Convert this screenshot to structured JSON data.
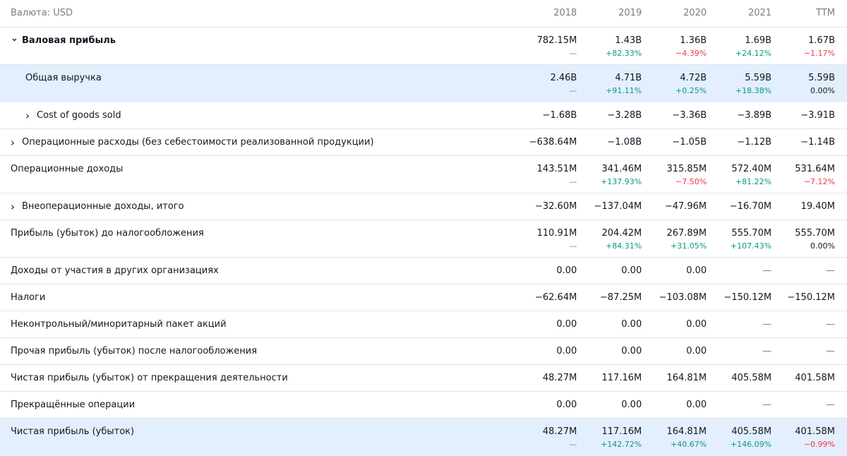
{
  "header": {
    "currency_label": "Валюта: USD",
    "years": [
      "2018",
      "2019",
      "2020",
      "2021",
      "TTM"
    ]
  },
  "rows": [
    {
      "label": "Валовая прибыль",
      "bold": true,
      "chevron": "chevron-down",
      "values": [
        "782.15M",
        "1.43B",
        "1.36B",
        "1.69B",
        "1.67B"
      ],
      "changes": [
        "—",
        "+82.33%",
        "−4.39%",
        "+24.12%",
        "−1.17%"
      ]
    },
    {
      "label": "Общая выручка",
      "highlight": true,
      "indent": true,
      "values": [
        "2.46B",
        "4.71B",
        "4.72B",
        "5.59B",
        "5.59B"
      ],
      "changes": [
        "—",
        "+91.11%",
        "+0.25%",
        "+18.38%",
        "0.00%"
      ]
    },
    {
      "label": "Cost of goods sold",
      "indent": true,
      "chevron": "chevron-right",
      "values": [
        "−1.68B",
        "−3.28B",
        "−3.36B",
        "−3.89B",
        "−3.91B"
      ]
    },
    {
      "label": "Операционные расходы (без себестоимости реализованной продукции)",
      "chevron": "chevron-right",
      "values": [
        "−638.64M",
        "−1.08B",
        "−1.05B",
        "−1.12B",
        "−1.14B"
      ]
    },
    {
      "label": "Операционные доходы",
      "values": [
        "143.51M",
        "341.46M",
        "315.85M",
        "572.40M",
        "531.64M"
      ],
      "changes": [
        "—",
        "+137.93%",
        "−7.50%",
        "+81.22%",
        "−7.12%"
      ]
    },
    {
      "label": "Внеоперационные доходы, итого",
      "chevron": "chevron-right",
      "values": [
        "−32.60M",
        "−137.04M",
        "−47.96M",
        "−16.70M",
        "19.40M"
      ]
    },
    {
      "label": "Прибыль (убыток) до налогообложения",
      "values": [
        "110.91M",
        "204.42M",
        "267.89M",
        "555.70M",
        "555.70M"
      ],
      "changes": [
        "—",
        "+84.31%",
        "+31.05%",
        "+107.43%",
        "0.00%"
      ]
    },
    {
      "label": "Доходы от участия в других организациях",
      "values": [
        "0.00",
        "0.00",
        "0.00",
        "—",
        "—"
      ]
    },
    {
      "label": "Налоги",
      "values": [
        "−62.64M",
        "−87.25M",
        "−103.08M",
        "−150.12M",
        "−150.12M"
      ]
    },
    {
      "label": "Неконтрольный/миноритарный пакет акций",
      "values": [
        "0.00",
        "0.00",
        "0.00",
        "—",
        "—"
      ]
    },
    {
      "label": "Прочая прибыль (убыток) после налогообложения",
      "values": [
        "0.00",
        "0.00",
        "0.00",
        "—",
        "—"
      ]
    },
    {
      "label": "Чистая прибыль (убыток) от прекращения деятельности",
      "values": [
        "48.27M",
        "117.16M",
        "164.81M",
        "405.58M",
        "401.58M"
      ]
    },
    {
      "label": "Прекращённые операции",
      "values": [
        "0.00",
        "0.00",
        "0.00",
        "—",
        "—"
      ]
    },
    {
      "label": "Чистая прибыль (убыток)",
      "highlight": true,
      "values": [
        "48.27M",
        "117.16M",
        "164.81M",
        "405.58M",
        "401.58M"
      ],
      "changes": [
        "—",
        "+142.72%",
        "+40.67%",
        "+146.09%",
        "−0.99%"
      ]
    }
  ],
  "colors": {
    "positive": "#089981",
    "negative": "#f23645",
    "highlight": "#e3effd"
  }
}
